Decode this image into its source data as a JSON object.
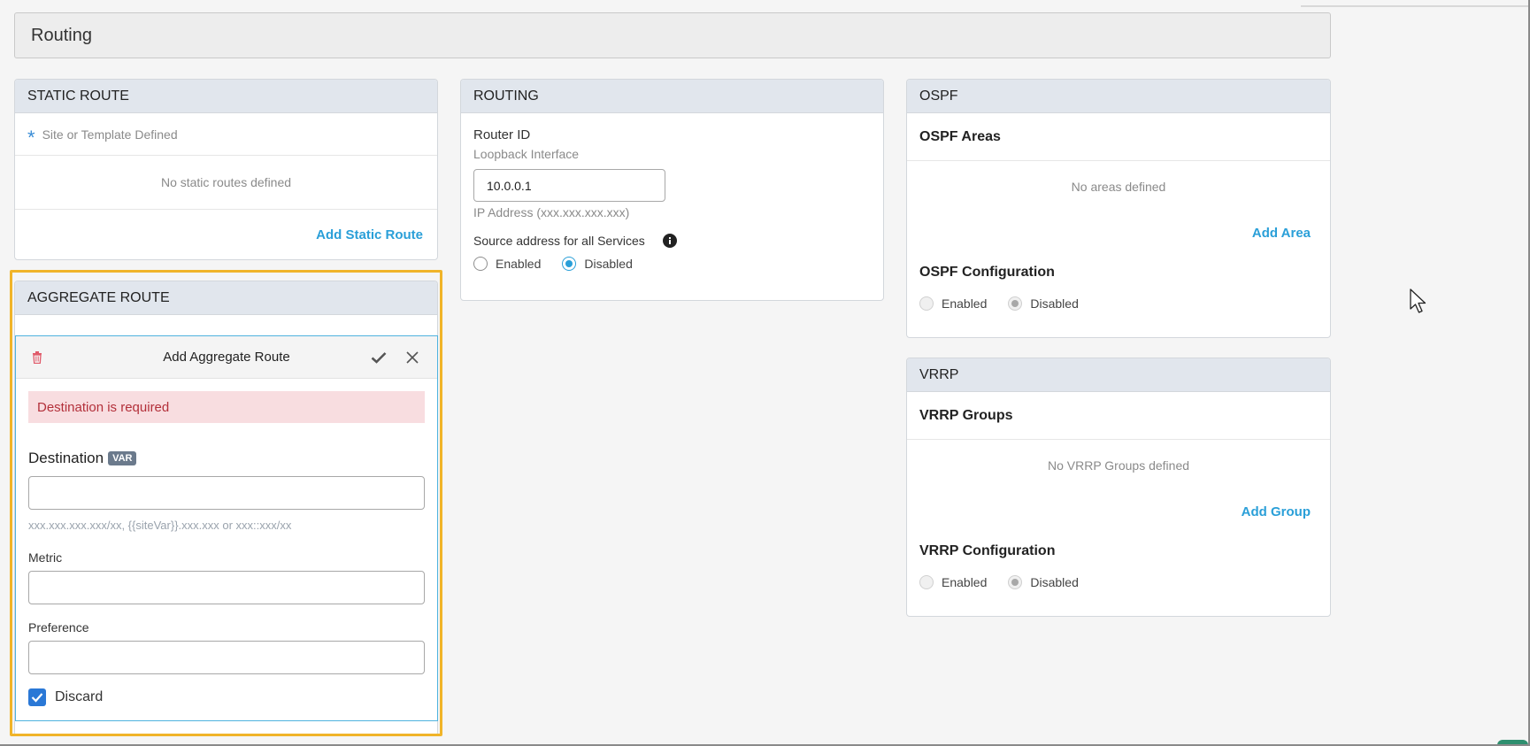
{
  "page": {
    "title": "Routing"
  },
  "static_route": {
    "header": "STATIC ROUTE",
    "site_defined": "Site or Template Defined",
    "empty": "No static routes defined",
    "add_link": "Add Static Route"
  },
  "routing": {
    "header": "ROUTING",
    "router_id_label": "Router ID",
    "router_id_sub": "Loopback Interface",
    "router_id_value": "10.0.0.1",
    "ip_hint": "IP Address (xxx.xxx.xxx.xxx)",
    "source_label": "Source address for all Services",
    "enabled": "Enabled",
    "disabled": "Disabled",
    "selected": "Disabled"
  },
  "ospf": {
    "header": "OSPF",
    "areas_title": "OSPF Areas",
    "empty": "No areas defined",
    "add_link": "Add Area",
    "config_title": "OSPF Configuration",
    "enabled": "Enabled",
    "disabled": "Disabled",
    "selected": "Disabled"
  },
  "vrrp": {
    "header": "VRRP",
    "groups_title": "VRRP Groups",
    "empty": "No VRRP Groups defined",
    "add_link": "Add Group",
    "config_title": "VRRP Configuration",
    "enabled": "Enabled",
    "disabled": "Disabled",
    "selected": "Disabled"
  },
  "aggregate_route": {
    "header": "AGGREGATE ROUTE",
    "form_title": "Add Aggregate Route",
    "error": "Destination is required",
    "destination_label": "Destination",
    "var_badge": "VAR",
    "destination_value": "",
    "destination_hint": "xxx.xxx.xxx.xxx/xx, {{siteVar}}.xxx.xxx or xxx::xxx/xx",
    "metric_label": "Metric",
    "metric_value": "",
    "preference_label": "Preference",
    "preference_value": "",
    "discard_label": "Discard",
    "discard_checked": true
  },
  "colors": {
    "accent": "#2a9fd8",
    "highlight": "#f0b429",
    "error_bg": "#f8dde0",
    "error_text": "#b3303a",
    "card_header": "#e1e6ed"
  }
}
